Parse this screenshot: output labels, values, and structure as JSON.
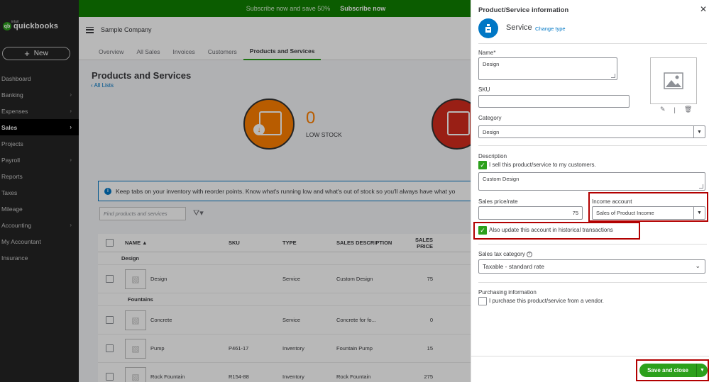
{
  "banner": {
    "text": "Subscribe now and save 50%",
    "cta": "Subscribe now"
  },
  "brand": {
    "small": "intuit",
    "name": "quickbooks"
  },
  "new_button": {
    "label": "New"
  },
  "nav": [
    {
      "label": "Dashboard",
      "chevron": ""
    },
    {
      "label": "Banking",
      "chevron": "›"
    },
    {
      "label": "Expenses",
      "chevron": "›"
    },
    {
      "label": "Sales",
      "chevron": "›"
    },
    {
      "label": "Projects",
      "chevron": ""
    },
    {
      "label": "Payroll",
      "chevron": "›"
    },
    {
      "label": "Reports",
      "chevron": ""
    },
    {
      "label": "Taxes",
      "chevron": ""
    },
    {
      "label": "Mileage",
      "chevron": ""
    },
    {
      "label": "Accounting",
      "chevron": "›"
    },
    {
      "label": "My Accountant",
      "chevron": ""
    },
    {
      "label": "Insurance",
      "chevron": ""
    }
  ],
  "header": {
    "company": "Sample Company"
  },
  "tabs": [
    "Overview",
    "All Sales",
    "Invoices",
    "Customers",
    "Products and Services"
  ],
  "main": {
    "title": "Products and Services",
    "back_link": "All Lists",
    "low_stock_count": "0",
    "low_stock_label": "LOW STOCK",
    "info_text": "Keep tabs on your inventory with reorder points. Know what's running low and what's out of stock so you'll always have what yo",
    "search_placeholder": "Find products and services",
    "columns": [
      "NAME ▲",
      "SKU",
      "TYPE",
      "SALES DESCRIPTION",
      "SALES PRICE"
    ],
    "groups": [
      {
        "name": "Design",
        "rows": [
          {
            "name": "Design",
            "sku": "",
            "type": "Service",
            "desc": "Custom Design",
            "price": "75"
          }
        ]
      },
      {
        "name": "Fountains",
        "rows": [
          {
            "name": "Concrete",
            "sku": "",
            "type": "Service",
            "desc": "Concrete for fo...",
            "price": "0"
          },
          {
            "name": "Pump",
            "sku": "P461-17",
            "type": "Inventory",
            "desc": "Fountain Pump",
            "price": "15"
          },
          {
            "name": "Rock Fountain",
            "sku": "R154-88",
            "type": "Inventory",
            "desc": "Rock Fountain",
            "price": "275"
          }
        ]
      }
    ]
  },
  "panel": {
    "title": "Product/Service information",
    "type_label": "Service",
    "change_type": "Change type",
    "name_label": "Name*",
    "name_value": "Design",
    "sku_label": "SKU",
    "sku_value": "",
    "category_label": "Category",
    "category_value": "Design",
    "description_label": "Description",
    "sell_checkbox_label": "I sell this product/service to my customers.",
    "description_value": "Custom Design",
    "sales_price_label": "Sales price/rate",
    "sales_price_value": "75",
    "income_account_label": "Income account",
    "income_account_value": "Sales of Product Income",
    "historical_label": "Also update this account in historical transactions",
    "sales_tax_label": "Sales tax category",
    "sales_tax_value": "Taxable - standard rate",
    "purchasing_label": "Purchasing information",
    "purchase_checkbox_label": "I purchase this product/service from a vendor.",
    "save_label": "Save and close"
  },
  "colors": {
    "brand_green": "#2ca01c",
    "banner_green": "#108000",
    "link_blue": "#0077c5",
    "highlight_red": "#b20000",
    "sidebar": "#242424"
  }
}
